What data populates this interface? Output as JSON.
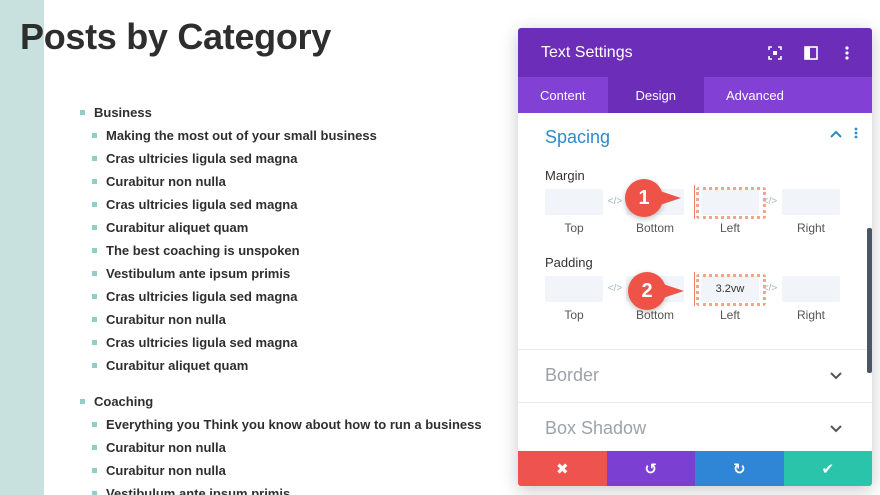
{
  "page": {
    "title": "Posts by Category"
  },
  "categories": [
    {
      "name": "Business",
      "posts": [
        "Making the most out of your small business",
        "Cras ultricies ligula sed magna",
        "Curabitur non nulla",
        "Cras ultricies ligula sed magna",
        "Curabitur aliquet quam",
        "The best coaching is unspoken",
        "Vestibulum ante ipsum primis",
        "Cras ultricies ligula sed magna",
        "Curabitur non nulla",
        "Cras ultricies ligula sed magna",
        "Curabitur aliquet quam"
      ]
    },
    {
      "name": "Coaching",
      "posts": [
        "Everything you Think you know about how to run a business",
        "Curabitur non nulla",
        "Curabitur non nulla",
        "Vestibulum ante ipsum primis"
      ]
    }
  ],
  "modal": {
    "title": "Text Settings",
    "icons": [
      "focus-icon",
      "split-view-icon",
      "more-vertical-icon"
    ],
    "tabs": [
      {
        "label": "Content",
        "active": false
      },
      {
        "label": "Design",
        "active": true
      },
      {
        "label": "Advanced",
        "active": false
      }
    ],
    "spacing": {
      "title": "Spacing",
      "margin": {
        "label": "Margin",
        "top": "",
        "bottom": "",
        "left": "",
        "right": ""
      },
      "padding": {
        "label": "Padding",
        "top": "",
        "bottom": "",
        "left": "3.2vw",
        "right": ""
      },
      "sub_labels": [
        "Top",
        "Bottom",
        "Left",
        "Right"
      ]
    },
    "collapsed_sections": [
      "Border",
      "Box Shadow"
    ],
    "footer": {
      "buttons": [
        {
          "name": "cancel",
          "icon": "close-icon",
          "glyph": "✖",
          "color": "#ef5350"
        },
        {
          "name": "undo",
          "icon": "undo-icon",
          "glyph": "↺",
          "color": "#7b3fd2"
        },
        {
          "name": "redo",
          "icon": "redo-icon",
          "glyph": "↻",
          "color": "#2f86d6"
        },
        {
          "name": "save",
          "icon": "check-icon",
          "glyph": "✔",
          "color": "#29c4a9"
        }
      ]
    }
  },
  "annotations": {
    "badge_1": "1",
    "badge_2": "2"
  },
  "colors": {
    "accent_purple": "#6c2eb9",
    "tab_bar": "#8240d4",
    "section_blue": "#2e8bc9",
    "strip_teal": "#c9e1de",
    "badge_red": "#ef5246"
  }
}
